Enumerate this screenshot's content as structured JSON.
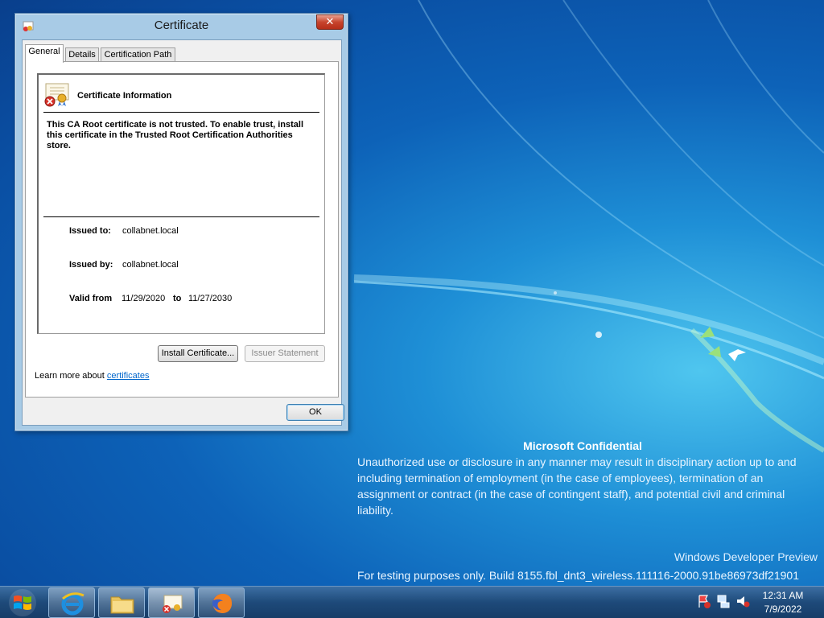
{
  "dialog": {
    "title": "Certificate",
    "close_glyph": "✕",
    "tabs": [
      {
        "label": "General",
        "active": true
      },
      {
        "label": "Details",
        "active": false
      },
      {
        "label": "Certification Path",
        "active": false
      }
    ],
    "general": {
      "heading": "Certificate Information",
      "warning": "This CA Root certificate is not trusted. To enable trust, install this certificate in the Trusted Root Certification Authorities store.",
      "issued_to_label": "Issued to:",
      "issued_to_value": "collabnet.local",
      "issued_by_label": "Issued by:",
      "issued_by_value": "collabnet.local",
      "valid_from_label": "Valid from",
      "valid_from_value": "11/29/2020",
      "valid_to_label": "to",
      "valid_to_value": "11/27/2030",
      "install_button": "Install Certificate...",
      "issuer_button": "Issuer Statement",
      "learn_prefix": "Learn more about ",
      "learn_link": "certificates"
    },
    "ok_button": "OK"
  },
  "desktop": {
    "confidential_title": "Microsoft Confidential",
    "confidential_body": "Unauthorized use or disclosure in any manner may result in disciplinary action up to and including termination of employment (in the case of employees), termination of an assignment or contract (in the case of contingent staff), and potential civil and criminal liability.",
    "watermark_title": "Windows Developer Preview",
    "watermark_build": "For testing purposes only. Build 8155.fbl_dnt3_wireless.111116-2000.91be86973df21901"
  },
  "taskbar": {
    "start_icon": "windows-logo-icon",
    "pinned": [
      "internet-explorer-icon",
      "file-explorer-icon",
      "certificate-icon",
      "firefox-icon"
    ],
    "tray_icons": [
      "action-center-flag-icon",
      "network-icon",
      "volume-muted-icon"
    ],
    "time": "12:31 AM",
    "date": "7/9/2022"
  },
  "colors": {
    "desktop_blue": "#0d62b8",
    "close_red": "#c7442d",
    "link_blue": "#0066cc"
  }
}
